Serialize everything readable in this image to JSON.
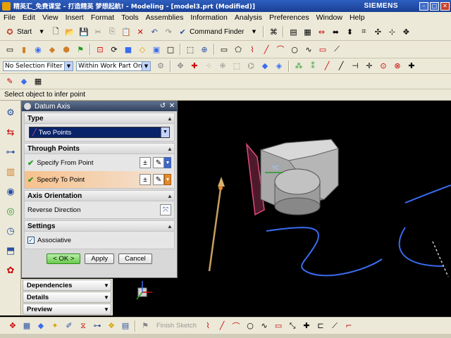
{
  "window": {
    "title": "精英汇_免费课堂 - 打造精英 梦想起航! - Modeling - [model3.prt (Modified)]",
    "brand": "SIEMENS"
  },
  "menu": [
    "File",
    "Edit",
    "View",
    "Insert",
    "Format",
    "Tools",
    "Assemblies",
    "Information",
    "Analysis",
    "Preferences",
    "Window",
    "Help"
  ],
  "toolbar1": {
    "start_label": "Start",
    "command_finder_label": "Command Finder"
  },
  "filters": {
    "selection_filter": "No Selection Filter",
    "scope": "Within Work Part Only"
  },
  "status": "Select object to infer point",
  "dialog": {
    "title": "Datum Axis",
    "type_group": "Type",
    "type_value": "Two Points",
    "through_points_group": "Through Points",
    "from_point_label": "Specify From Point",
    "to_point_label": "Specify To Point",
    "axis_orientation_group": "Axis Orientation",
    "reverse_label": "Reverse Direction",
    "settings_group": "Settings",
    "associative_label": "Associative",
    "ok_label": "< OK >",
    "apply_label": "Apply",
    "cancel_label": "Cancel"
  },
  "nav_panels": [
    "Dependencies",
    "Details",
    "Preview"
  ],
  "bottom_toolbar": {
    "finish_sketch_label": "Finish Sketch"
  },
  "canvas": {
    "csys_label": "YC"
  },
  "colors": {
    "titlebar": "#2e5fbf",
    "active_row": "#f7c18c",
    "curve": "#3a6cf0",
    "datum_plane": "#e04a7a",
    "solid": "#c8c8c8"
  }
}
